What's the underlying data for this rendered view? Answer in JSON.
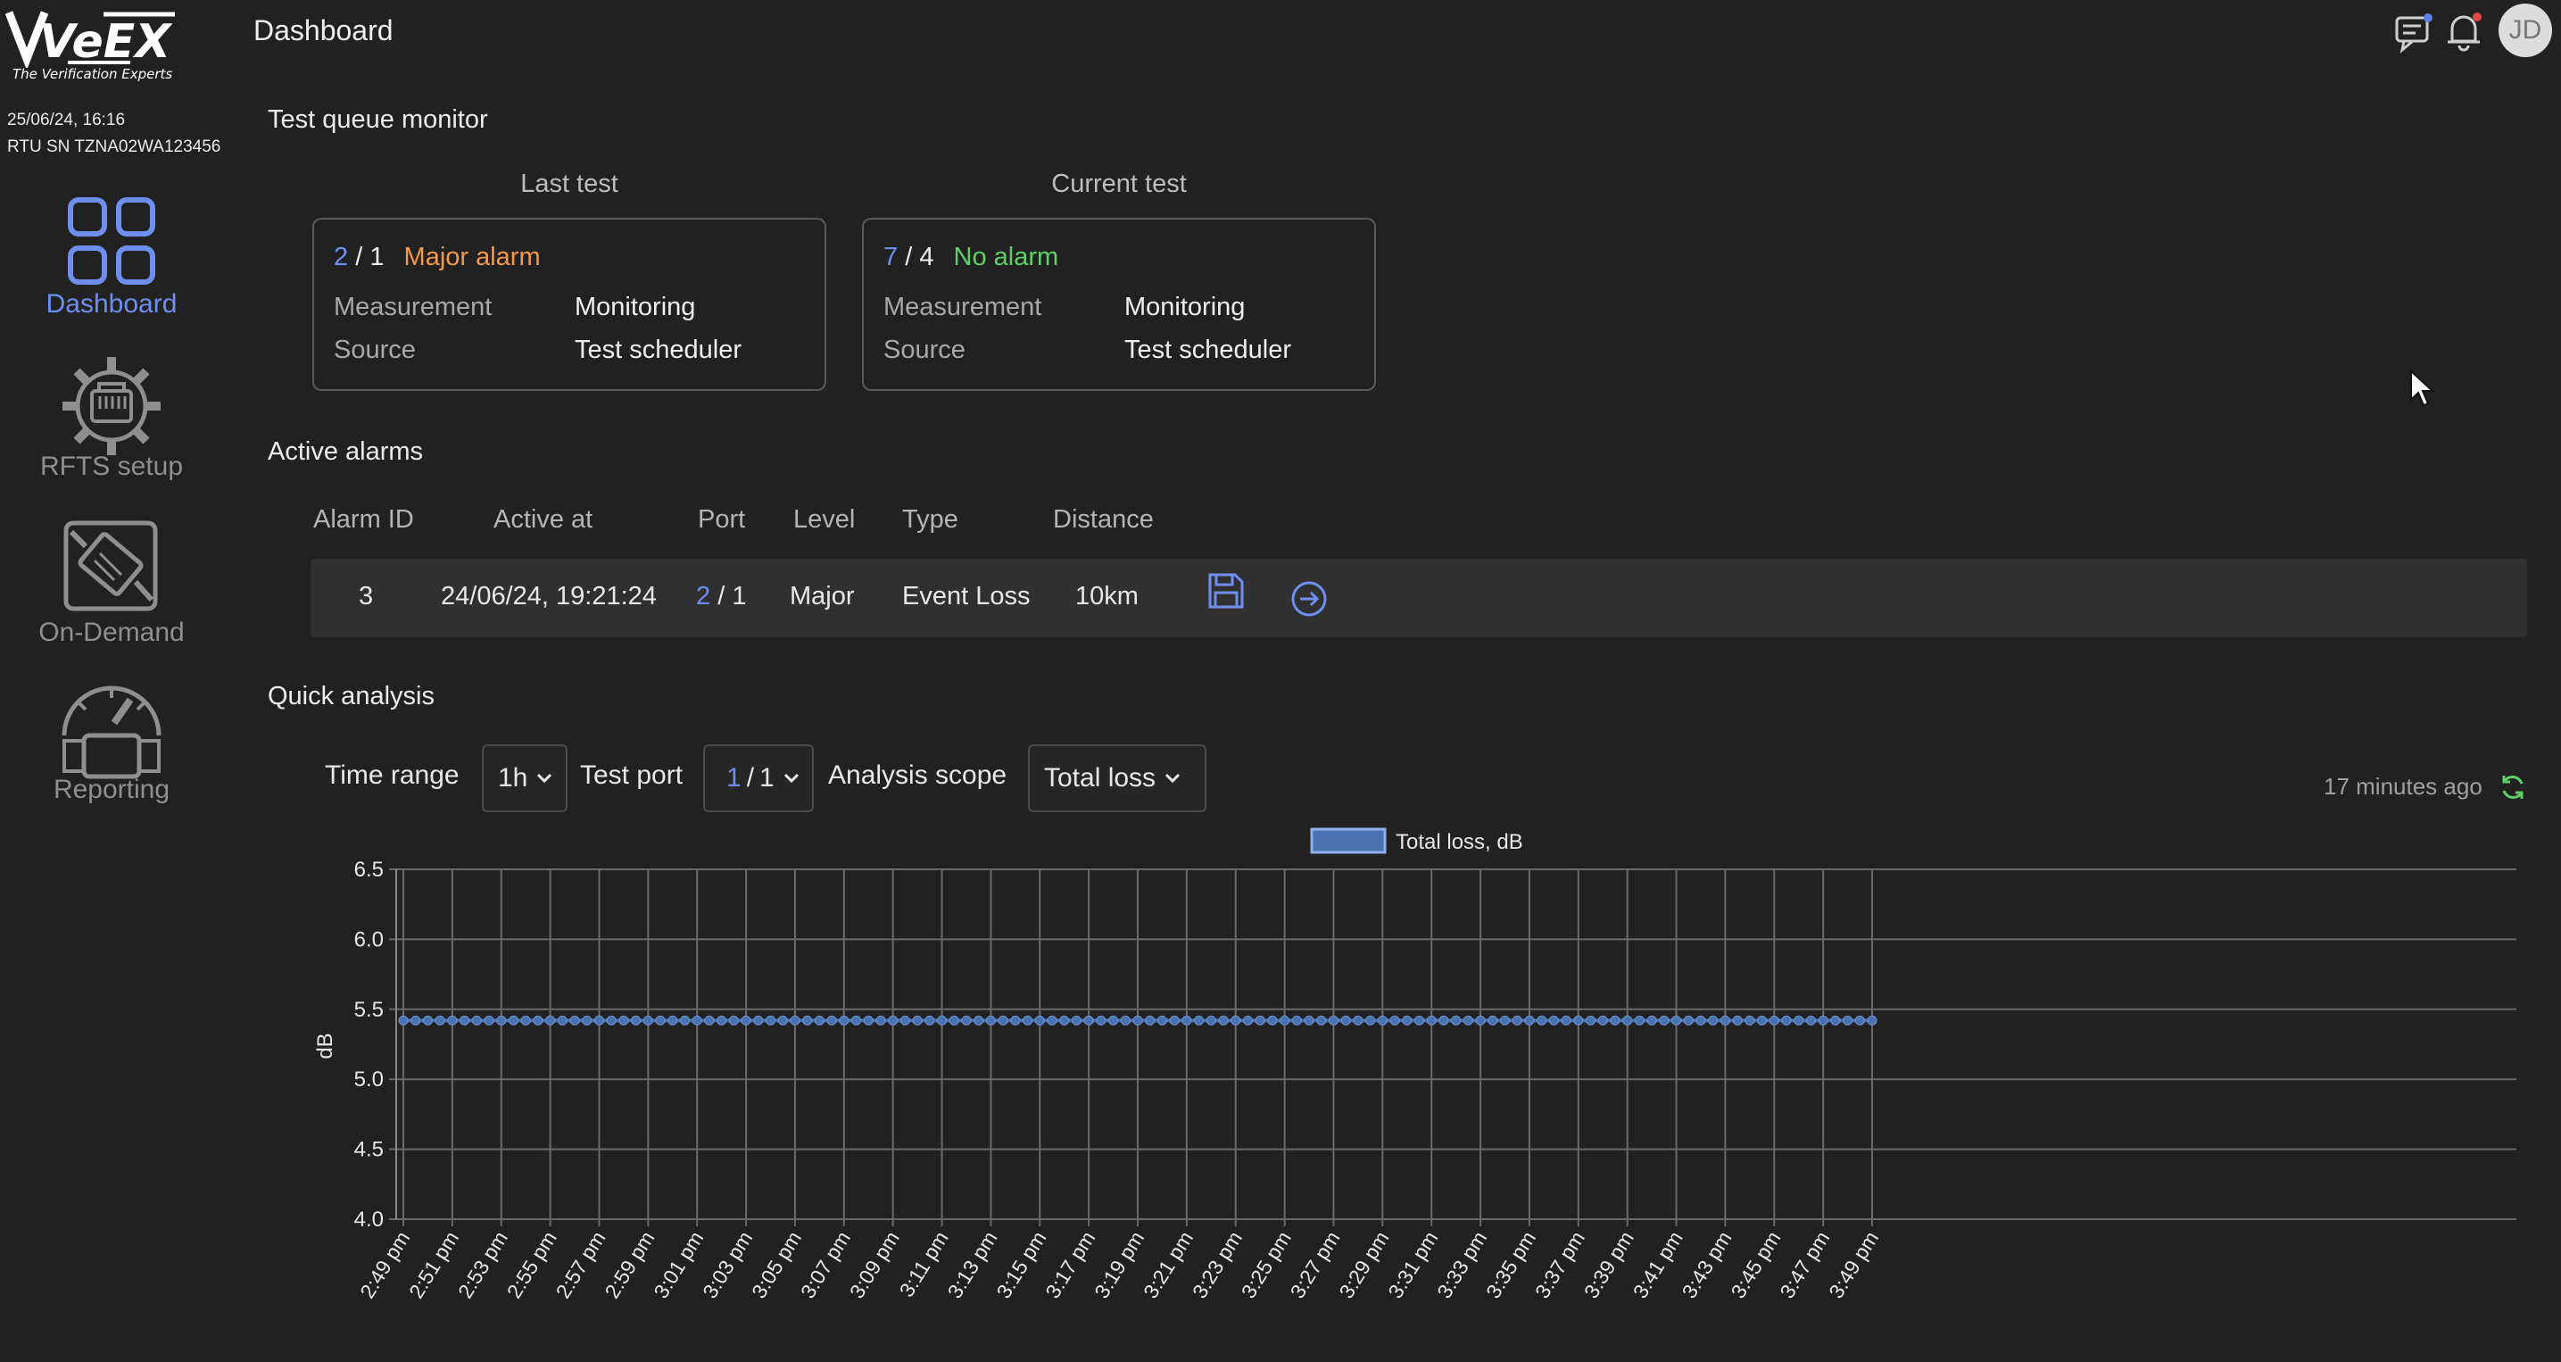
{
  "sidebar": {
    "logo": {
      "text": "VeEX",
      "tagline": "The Verification Experts"
    },
    "datetime": "25/06/24, 16:16",
    "rtu_sn": "RTU SN TZNA02WA123456",
    "items": [
      {
        "label": "Dashboard",
        "icon": "dashboard-grid-icon",
        "active": true
      },
      {
        "label": "RFTS setup",
        "icon": "gear-module-icon",
        "active": false
      },
      {
        "label": "On-Demand",
        "icon": "on-demand-icon",
        "active": false
      },
      {
        "label": "Reporting",
        "icon": "gauge-icon",
        "active": false
      }
    ]
  },
  "header": {
    "title": "Dashboard",
    "avatar_initials": "JD",
    "icons": [
      "chat-icon",
      "bell-icon"
    ]
  },
  "test_queue": {
    "title": "Test queue monitor",
    "last": {
      "heading": "Last test",
      "port_a": "2",
      "port_sep": "/",
      "port_b": "1",
      "status": "Major alarm",
      "measurement_label": "Measurement",
      "measurement_value": "Monitoring",
      "source_label": "Source",
      "source_value": "Test scheduler"
    },
    "current": {
      "heading": "Current test",
      "port_a": "7",
      "port_sep": "/",
      "port_b": "4",
      "status": "No alarm",
      "measurement_label": "Measurement",
      "measurement_value": "Monitoring",
      "source_label": "Source",
      "source_value": "Test scheduler"
    }
  },
  "alarms": {
    "title": "Active alarms",
    "columns": [
      "Alarm ID",
      "Active at",
      "Port",
      "Level",
      "Type",
      "Distance"
    ],
    "rows": [
      {
        "id": "3",
        "active_at": "24/06/24, 19:21:24",
        "port_a": "2",
        "port_sep": "/",
        "port_b": "1",
        "level": "Major",
        "type": "Event Loss",
        "distance": "10km"
      }
    ]
  },
  "quick_analysis": {
    "title": "Quick analysis",
    "time_range_label": "Time range",
    "time_range_value": "1h",
    "test_port_label": "Test port",
    "test_port_a": "1",
    "test_port_sep": "/",
    "test_port_b": "1",
    "scope_label": "Analysis scope",
    "scope_value": "Total loss",
    "updated": "17 minutes ago"
  },
  "colors": {
    "accent": "#6f8ff0",
    "major": "#f29a4a",
    "ok": "#5fd068",
    "series": "#4a72b0"
  },
  "chart_data": {
    "type": "line",
    "legend": "Total loss, dB",
    "ylabel": "dB",
    "ylim": [
      4.0,
      6.5
    ],
    "yticks": [
      "6.5",
      "6.0",
      "5.5",
      "5.0",
      "4.5",
      "4.0"
    ],
    "xticks": [
      "2:49 pm",
      "2:51 pm",
      "2:53 pm",
      "2:55 pm",
      "2:57 pm",
      "2:59 pm",
      "3:01 pm",
      "3:03 pm",
      "3:05 pm",
      "3:07 pm",
      "3:09 pm",
      "3:11 pm",
      "3:13 pm",
      "3:15 pm",
      "3:17 pm",
      "3:19 pm",
      "3:21 pm",
      "3:23 pm",
      "3:25 pm",
      "3:27 pm",
      "3:29 pm",
      "3:31 pm",
      "3:33 pm",
      "3:35 pm",
      "3:37 pm",
      "3:39 pm",
      "3:41 pm",
      "3:43 pm",
      "3:45 pm",
      "3:47 pm",
      "3:49 pm"
    ],
    "series": [
      {
        "name": "Total loss, dB",
        "x_start": "2:49 pm",
        "x_end": "3:49 pm",
        "count": 121,
        "value": 5.42
      }
    ],
    "grid": true,
    "legend_position": "top-center"
  }
}
